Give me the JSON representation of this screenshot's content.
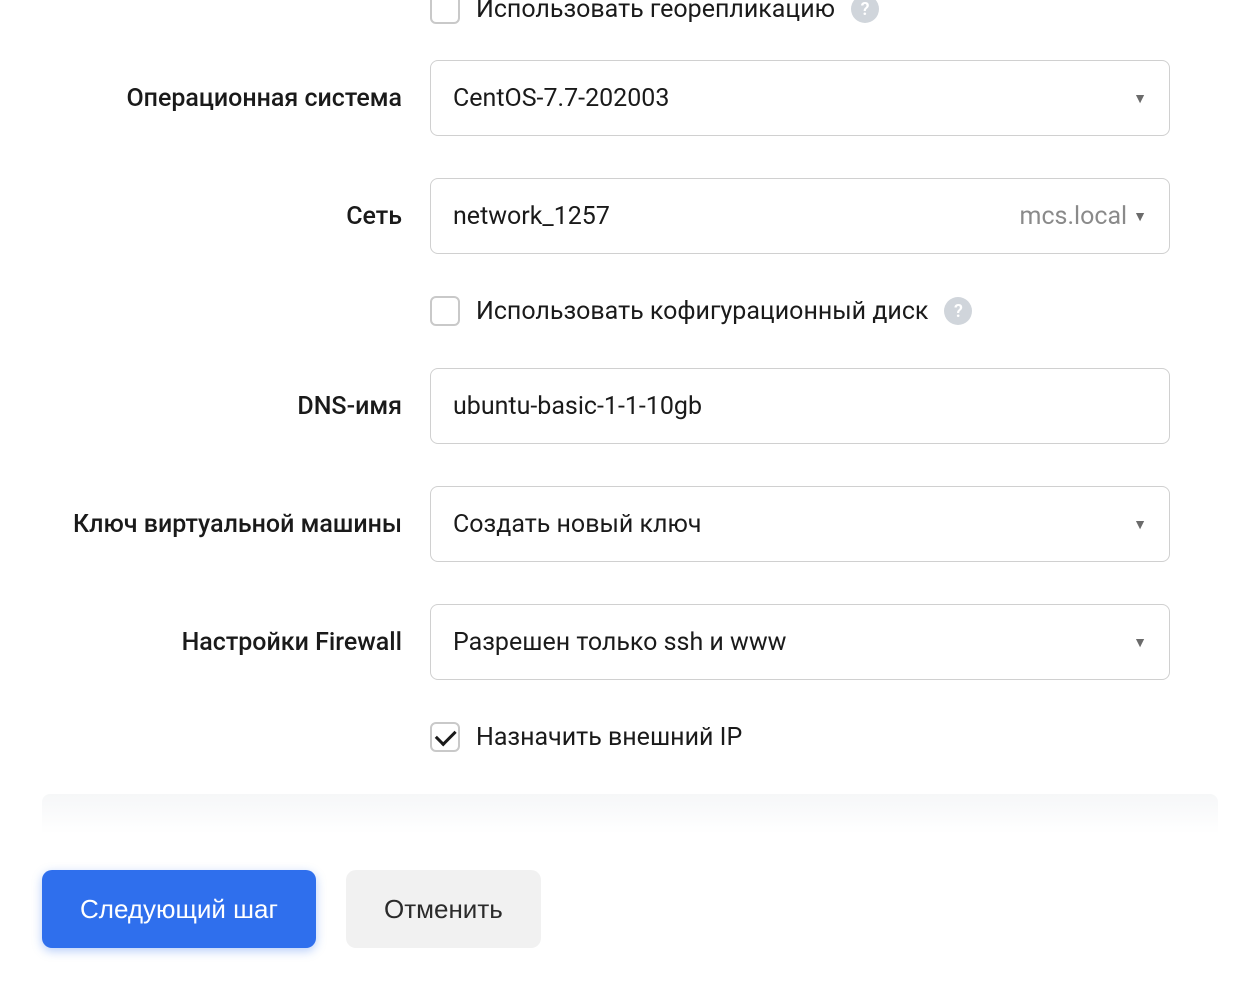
{
  "fields": {
    "georeplication": {
      "label": "Использовать георепликацию",
      "checked": false
    },
    "os": {
      "label": "Операционная система",
      "value": "CentOS-7.7-202003"
    },
    "network": {
      "label": "Сеть",
      "value": "network_1257",
      "suffix": "mcs.local"
    },
    "config_disk": {
      "label": "Использовать кофигурационный диск",
      "checked": false
    },
    "dns_name": {
      "label": "DNS-имя",
      "value": "ubuntu-basic-1-1-10gb"
    },
    "vm_key": {
      "label": "Ключ виртуальной машины",
      "value": "Создать новый ключ"
    },
    "firewall": {
      "label": "Настройки Firewall",
      "value": "Разрешен только ssh и www"
    },
    "external_ip": {
      "label": "Назначить внешний IP",
      "checked": true
    }
  },
  "buttons": {
    "next": "Следующий шаг",
    "cancel": "Отменить"
  }
}
